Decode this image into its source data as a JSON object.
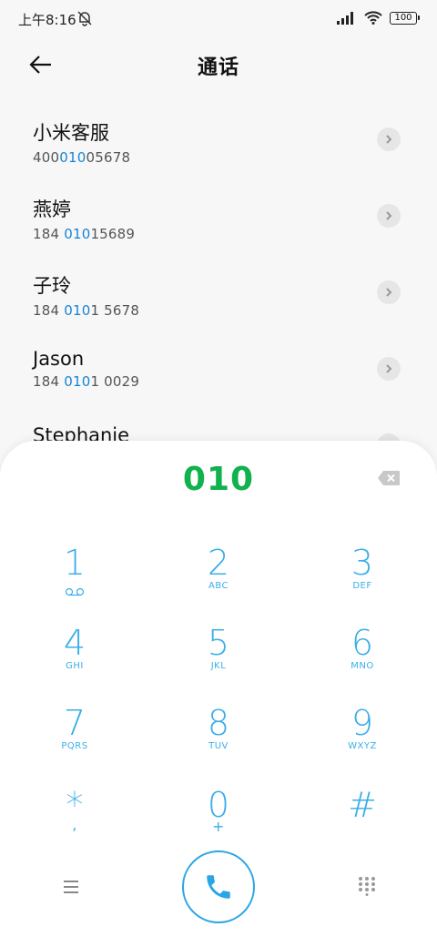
{
  "status": {
    "time": "上午8:16",
    "battery": "100"
  },
  "header": {
    "title": "通话"
  },
  "contacts": [
    {
      "name": "小米客服",
      "number_pre": "400",
      "number_hl": "010",
      "number_post": "05678"
    },
    {
      "name": "燕婷",
      "number_pre": "184 ",
      "number_hl": "010",
      "number_post": "15689"
    },
    {
      "name": "子玲",
      "number_pre": "184 ",
      "number_hl": "010",
      "number_post": "1 5678"
    },
    {
      "name": "Jason",
      "number_pre": "184 ",
      "number_hl": "010",
      "number_post": "1 0029"
    },
    {
      "name": "Stephanie",
      "number_pre": "",
      "number_hl": "",
      "number_post": ""
    }
  ],
  "dialer": {
    "entered": "010",
    "keys": [
      {
        "digit": "1",
        "letters": ""
      },
      {
        "digit": "2",
        "letters": "ABC"
      },
      {
        "digit": "3",
        "letters": "DEF"
      },
      {
        "digit": "4",
        "letters": "GHI"
      },
      {
        "digit": "5",
        "letters": "JKL"
      },
      {
        "digit": "6",
        "letters": "MNO"
      },
      {
        "digit": "7",
        "letters": "PQRS"
      },
      {
        "digit": "8",
        "letters": "TUV"
      },
      {
        "digit": "9",
        "letters": "WXYZ"
      },
      {
        "digit": "*",
        "letters": ","
      },
      {
        "digit": "0",
        "letters": "+"
      },
      {
        "digit": "#",
        "letters": ""
      }
    ]
  },
  "colors": {
    "accent": "#2aa5e6",
    "entered": "#11b14e",
    "highlight": "#1685d6"
  },
  "icons": {
    "back": "arrow-left-icon",
    "chevron": "chevron-right-icon",
    "backspace": "backspace-icon",
    "voicemail": "voicemail-icon",
    "menu": "menu-icon",
    "call": "phone-icon",
    "grid": "dialpad-grid-icon",
    "mute": "bell-off-icon",
    "signal": "signal-icon",
    "wifi": "wifi-icon"
  }
}
